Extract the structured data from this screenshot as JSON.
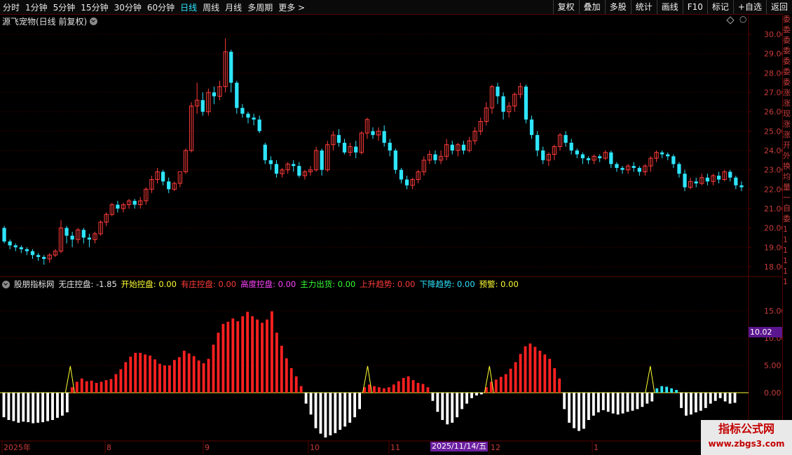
{
  "toolbar": {
    "tabs": [
      "分时",
      "1分钟",
      "5分钟",
      "15分钟",
      "30分钟",
      "60分钟",
      "日线",
      "周线",
      "月线",
      "多周期",
      "更多 >"
    ],
    "active_tab": "日线",
    "buttons": [
      "复权",
      "叠加",
      "多股",
      "统计",
      "画线",
      "F10",
      "标记",
      "+自选",
      "返回"
    ]
  },
  "main": {
    "title": "源飞宠物(日线 前复权)",
    "price_ticks": [
      "30.00",
      "29.00",
      "28.00",
      "27.00",
      "26.00",
      "25.00",
      "24.00",
      "23.00",
      "22.00",
      "21.00",
      "20.00",
      "19.00",
      "18.00"
    ]
  },
  "indicator": {
    "source": "股朋指标网",
    "items": [
      {
        "label": "无庄控盘:",
        "value": "-1.85",
        "color": "#e8e8e8"
      },
      {
        "label": "开始控盘:",
        "value": "0.00",
        "color": "#ffff33"
      },
      {
        "label": "有庄控盘:",
        "value": "0.00",
        "color": "#ff3b3b"
      },
      {
        "label": "高度控盘:",
        "value": "0.00",
        "color": "#ff44ff"
      },
      {
        "label": "主力出货:",
        "value": "0.00",
        "color": "#33ff33"
      },
      {
        "label": "上升趋势:",
        "value": "0.00",
        "color": "#ff3b3b"
      },
      {
        "label": "下降趋势:",
        "value": "0.00",
        "color": "#2ee5ff"
      },
      {
        "label": "预警:",
        "value": "0.00",
        "color": "#ffff33"
      }
    ],
    "ticks": [
      "15.00",
      "10.00",
      "5.00",
      "0.00"
    ],
    "current_value": "10.02"
  },
  "xaxis": {
    "labels": [
      "2025年",
      "8",
      "9",
      "10",
      "11",
      "12",
      "1"
    ],
    "cursor_date": "2025/11/14/五"
  },
  "right_panel": [
    "委",
    "委",
    "委",
    "委",
    "委",
    "委",
    "委",
    "涨",
    "涨",
    "现",
    "涨",
    "涨",
    "开",
    "外",
    "换",
    "均",
    "量",
    "一",
    "自",
    "委",
    "1",
    "1",
    "1",
    "1",
    "1",
    "1"
  ],
  "watermark": {
    "line1": "指标公式网",
    "line2": "www.zbgs3.com"
  },
  "colors": {
    "up": "#ff3b3b",
    "down": "#2ee5ff",
    "grid": "#5a0000",
    "bg": "#000000"
  },
  "chart_data": {
    "type": "candlestick",
    "ylim": [
      17.6,
      30.4
    ],
    "candles": [
      [
        20.0,
        19.3,
        20.1,
        19.2
      ],
      [
        19.3,
        19.1,
        19.4,
        18.9
      ],
      [
        19.1,
        19.0,
        19.2,
        18.8
      ],
      [
        19.0,
        18.9,
        19.1,
        18.7
      ],
      [
        18.9,
        18.8,
        19.0,
        18.6
      ],
      [
        18.8,
        18.6,
        18.9,
        18.4
      ],
      [
        18.6,
        18.5,
        18.7,
        18.3
      ],
      [
        18.5,
        18.4,
        18.6,
        18.1
      ],
      [
        18.4,
        18.6,
        18.7,
        18.2
      ],
      [
        18.6,
        18.8,
        18.9,
        18.5
      ],
      [
        18.8,
        20.0,
        20.4,
        18.7
      ],
      [
        20.0,
        19.6,
        20.1,
        19.2
      ],
      [
        19.6,
        19.4,
        19.8,
        19.0
      ],
      [
        19.4,
        19.9,
        20.0,
        19.2
      ],
      [
        19.9,
        19.5,
        20.0,
        19.2
      ],
      [
        19.5,
        19.4,
        19.7,
        19.0
      ],
      [
        19.4,
        19.7,
        19.8,
        19.2
      ],
      [
        19.7,
        20.3,
        20.4,
        19.6
      ],
      [
        20.3,
        20.7,
        20.8,
        20.1
      ],
      [
        20.7,
        21.2,
        21.3,
        20.6
      ],
      [
        21.2,
        21.0,
        21.4,
        20.8
      ],
      [
        21.0,
        21.2,
        21.3,
        20.8
      ],
      [
        21.2,
        21.4,
        21.5,
        21.0
      ],
      [
        21.4,
        21.2,
        21.5,
        21.0
      ],
      [
        21.2,
        21.4,
        21.6,
        21.0
      ],
      [
        21.4,
        22.0,
        22.1,
        21.2
      ],
      [
        22.0,
        22.5,
        22.7,
        21.8
      ],
      [
        22.5,
        22.9,
        23.1,
        22.3
      ],
      [
        22.9,
        22.4,
        23.0,
        22.2
      ],
      [
        22.4,
        22.0,
        22.6,
        21.8
      ],
      [
        22.0,
        22.3,
        22.4,
        21.9
      ],
      [
        22.3,
        22.9,
        22.8,
        22.1
      ],
      [
        22.9,
        24.0,
        24.1,
        22.8
      ],
      [
        24.0,
        26.3,
        26.5,
        23.9
      ],
      [
        26.3,
        26.6,
        27.5,
        25.9
      ],
      [
        26.6,
        26.0,
        27.0,
        25.8
      ],
      [
        26.0,
        27.0,
        27.2,
        25.8
      ],
      [
        27.0,
        26.8,
        27.3,
        26.4
      ],
      [
        26.8,
        27.3,
        27.6,
        26.6
      ],
      [
        27.3,
        29.1,
        29.8,
        27.0
      ],
      [
        29.1,
        27.5,
        29.2,
        27.0
      ],
      [
        27.5,
        26.2,
        27.6,
        25.9
      ],
      [
        26.2,
        25.9,
        26.4,
        25.7
      ],
      [
        25.9,
        25.7,
        26.0,
        25.4
      ],
      [
        25.7,
        25.6,
        25.9,
        25.3
      ],
      [
        25.6,
        25.0,
        25.8,
        24.9
      ],
      [
        24.3,
        23.5,
        24.4,
        23.3
      ],
      [
        23.5,
        23.3,
        23.7,
        23.0
      ],
      [
        23.3,
        22.8,
        23.5,
        22.6
      ],
      [
        22.8,
        23.0,
        23.1,
        22.6
      ],
      [
        23.0,
        23.3,
        23.4,
        22.8
      ],
      [
        23.3,
        23.2,
        23.5,
        22.9
      ],
      [
        23.2,
        22.7,
        23.4,
        22.6
      ],
      [
        22.7,
        22.9,
        23.0,
        22.5
      ],
      [
        22.9,
        23.0,
        23.2,
        22.7
      ],
      [
        23.0,
        24.0,
        24.2,
        22.9
      ],
      [
        24.0,
        23.0,
        24.1,
        22.7
      ],
      [
        23.0,
        24.3,
        24.5,
        22.9
      ],
      [
        24.3,
        24.8,
        25.0,
        24.0
      ],
      [
        24.8,
        24.4,
        25.1,
        24.2
      ],
      [
        24.4,
        23.9,
        24.6,
        23.8
      ],
      [
        23.9,
        24.2,
        24.4,
        23.7
      ],
      [
        24.2,
        23.9,
        24.5,
        23.6
      ],
      [
        23.9,
        24.9,
        25.0,
        23.8
      ],
      [
        24.9,
        25.6,
        25.7,
        24.6
      ],
      [
        25.0,
        24.8,
        25.2,
        24.6
      ],
      [
        24.8,
        25.0,
        25.2,
        24.5
      ],
      [
        25.0,
        24.4,
        25.3,
        24.2
      ],
      [
        24.4,
        24.0,
        24.6,
        23.7
      ],
      [
        24.0,
        23.0,
        24.1,
        22.8
      ],
      [
        23.0,
        22.5,
        23.1,
        22.3
      ],
      [
        22.5,
        22.2,
        22.7,
        22.0
      ],
      [
        22.2,
        22.5,
        22.6,
        22.0
      ],
      [
        22.5,
        22.9,
        23.0,
        22.3
      ],
      [
        22.9,
        23.5,
        23.7,
        22.7
      ],
      [
        23.5,
        23.8,
        24.0,
        23.3
      ],
      [
        23.8,
        23.5,
        24.0,
        23.3
      ],
      [
        23.5,
        23.7,
        24.0,
        23.3
      ],
      [
        23.7,
        24.3,
        24.6,
        23.5
      ],
      [
        24.3,
        24.0,
        24.5,
        23.8
      ],
      [
        24.0,
        24.3,
        24.4,
        23.7
      ],
      [
        24.3,
        24.0,
        24.5,
        23.8
      ],
      [
        24.0,
        24.5,
        24.7,
        23.9
      ],
      [
        24.5,
        25.0,
        25.2,
        24.3
      ],
      [
        25.0,
        25.5,
        25.7,
        24.8
      ],
      [
        25.5,
        26.2,
        26.5,
        25.3
      ],
      [
        26.2,
        27.3,
        27.4,
        25.9
      ],
      [
        27.3,
        26.8,
        27.5,
        26.4
      ],
      [
        26.8,
        26.0,
        27.0,
        25.6
      ],
      [
        26.0,
        26.3,
        26.5,
        25.7
      ],
      [
        26.3,
        26.9,
        27.0,
        26.0
      ],
      [
        26.9,
        27.3,
        27.5,
        26.7
      ],
      [
        27.3,
        25.6,
        27.4,
        25.4
      ],
      [
        25.6,
        24.8,
        25.8,
        24.6
      ],
      [
        24.8,
        24.0,
        25.0,
        23.7
      ],
      [
        24.0,
        23.5,
        24.2,
        23.3
      ],
      [
        23.5,
        23.8,
        23.9,
        23.2
      ],
      [
        23.8,
        24.2,
        24.3,
        23.5
      ],
      [
        24.2,
        24.8,
        24.9,
        24.0
      ],
      [
        24.8,
        24.4,
        25.0,
        24.2
      ],
      [
        24.4,
        24.0,
        24.6,
        23.8
      ],
      [
        24.0,
        23.8,
        24.1,
        23.6
      ],
      [
        23.8,
        23.6,
        23.9,
        23.3
      ],
      [
        23.6,
        23.5,
        23.7,
        23.3
      ],
      [
        23.5,
        23.7,
        23.8,
        23.3
      ],
      [
        23.7,
        23.6,
        23.8,
        23.4
      ],
      [
        23.6,
        23.9,
        24.0,
        23.5
      ],
      [
        23.9,
        23.3,
        24.0,
        23.1
      ],
      [
        23.3,
        23.1,
        23.4,
        22.9
      ],
      [
        23.1,
        23.0,
        23.2,
        22.8
      ],
      [
        23.0,
        23.2,
        23.3,
        22.8
      ],
      [
        23.2,
        23.1,
        23.4,
        22.9
      ],
      [
        23.1,
        22.9,
        23.2,
        22.7
      ],
      [
        22.9,
        23.2,
        23.3,
        22.7
      ],
      [
        23.2,
        23.6,
        23.7,
        22.9
      ],
      [
        23.6,
        23.9,
        24.0,
        23.4
      ],
      [
        23.9,
        23.8,
        24.0,
        23.6
      ],
      [
        23.8,
        23.7,
        23.9,
        23.5
      ],
      [
        23.7,
        23.3,
        23.8,
        23.1
      ],
      [
        23.3,
        22.8,
        23.4,
        22.6
      ],
      [
        22.8,
        22.1,
        23.0,
        21.9
      ],
      [
        22.1,
        22.4,
        22.6,
        22.0
      ],
      [
        22.4,
        22.3,
        22.6,
        22.1
      ],
      [
        22.3,
        22.6,
        22.8,
        22.2
      ],
      [
        22.6,
        22.4,
        22.8,
        22.2
      ],
      [
        22.4,
        22.7,
        22.8,
        22.2
      ],
      [
        22.7,
        22.5,
        22.9,
        22.3
      ],
      [
        22.5,
        22.9,
        23.0,
        22.4
      ],
      [
        22.9,
        22.6,
        23.0,
        22.4
      ],
      [
        22.6,
        22.2,
        22.7,
        22.0
      ],
      [
        22.2,
        22.1,
        22.4,
        21.9
      ]
    ],
    "indicator_bars": [
      -4.5,
      -5.0,
      -5.2,
      -5.5,
      -5.3,
      -5.4,
      -5.6,
      -5.5,
      -5.4,
      -5.2,
      -5.0,
      -4.6,
      -4.2,
      -3.6,
      1.0,
      2.0,
      2.6,
      2.1,
      2.2,
      1.8,
      2.0,
      2.3,
      2.5,
      3.4,
      4.3,
      5.6,
      6.6,
      7.3,
      7.3,
      7.0,
      6.8,
      6.1,
      5.3,
      5.0,
      5.0,
      6.0,
      6.5,
      7.7,
      7.2,
      6.7,
      5.9,
      5.4,
      6.2,
      8.8,
      11.0,
      12.6,
      13.0,
      13.6,
      13.1,
      14.0,
      14.8,
      14.0,
      13.4,
      12.8,
      13.4,
      14.9,
      11.0,
      8.6,
      6.3,
      4.5,
      3.0,
      1.2,
      -2.0,
      -4.0,
      -6.5,
      -7.5,
      -8.2,
      -7.8,
      -7.4,
      -6.8,
      -6.2,
      -5.5,
      -4.5,
      -3.0,
      1.0,
      1.5,
      1.2,
      1.0,
      0.8,
      1.0,
      1.5,
      2.1,
      2.7,
      3.0,
      2.3,
      1.8,
      1.6,
      1.0,
      -1.5,
      -3.5,
      -5.0,
      -5.8,
      -5.5,
      -4.5,
      -3.0,
      -2.0,
      -1.0,
      -0.5,
      -0.3,
      1.0,
      2.0,
      2.4,
      2.9,
      3.4,
      4.4,
      5.6,
      7.1,
      8.5,
      9.0,
      8.4,
      7.7,
      7.0,
      6.2,
      4.5,
      2.6,
      -3.0,
      -5.5,
      -6.5,
      -7.0,
      -6.6,
      -5.0,
      -4.2,
      -3.6,
      -3.2,
      -3.5,
      -3.8,
      -4.0,
      -3.8,
      -3.5,
      -3.3,
      -3.0,
      -2.6,
      -2.0,
      -1.6,
      0.8,
      1.2,
      1.1,
      0.8,
      0.5,
      -2.8,
      -4.2,
      -4.0,
      -3.6,
      -3.3,
      -2.8,
      -2.0,
      -1.5,
      -1.0,
      -1.6,
      -2.0,
      -1.85
    ]
  }
}
